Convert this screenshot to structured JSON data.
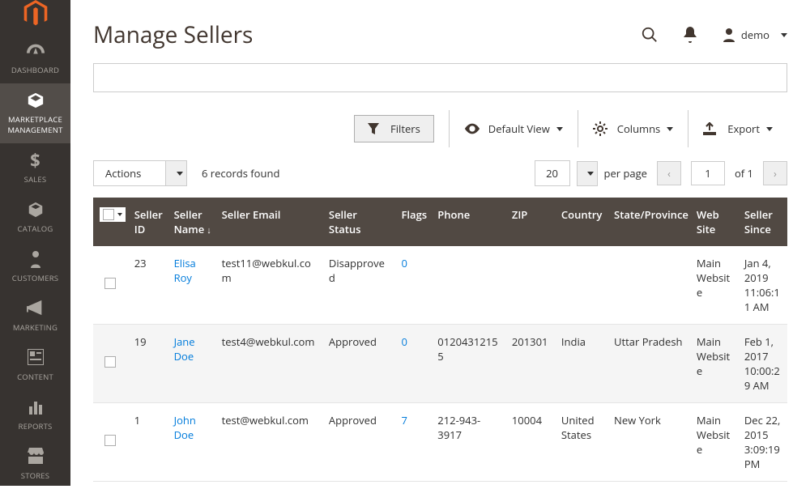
{
  "sidebar": {
    "items": [
      {
        "label": "DASHBOARD",
        "icon": "dashboard"
      },
      {
        "label": "MARKETPLACE MANAGEMENT",
        "icon": "marketplace",
        "active": true
      },
      {
        "label": "SALES",
        "icon": "sales"
      },
      {
        "label": "CATALOG",
        "icon": "catalog"
      },
      {
        "label": "CUSTOMERS",
        "icon": "customers"
      },
      {
        "label": "MARKETING",
        "icon": "marketing"
      },
      {
        "label": "CONTENT",
        "icon": "content"
      },
      {
        "label": "REPORTS",
        "icon": "reports"
      },
      {
        "label": "STORES",
        "icon": "stores"
      }
    ]
  },
  "header": {
    "title": "Manage Sellers",
    "user": "demo"
  },
  "toolbar": {
    "filters": "Filters",
    "view": "Default View",
    "columns": "Columns",
    "export": "Export"
  },
  "grid": {
    "actions": "Actions",
    "records": "6 records found",
    "per_page_value": "20",
    "per_page_label": "per page",
    "current_page": "1",
    "total_pages": "of 1"
  },
  "columns": [
    "Seller ID",
    "Seller Name",
    "Seller Email",
    "Seller Status",
    "Flags",
    "Phone",
    "ZIP",
    "Country",
    "State/Province",
    "Web Site",
    "Seller Since"
  ],
  "rows": [
    {
      "id": "23",
      "name": "Elisa Roy",
      "email": "test11@webkul.com",
      "status": "Disapproved",
      "flags": "0",
      "phone": "",
      "zip": "",
      "country": "",
      "state": "",
      "web": "Main Website",
      "since": "Jan 4, 2019 11:06:11 AM"
    },
    {
      "id": "19",
      "name": "Jane Doe",
      "email": "test4@webkul.com",
      "status": "Approved",
      "flags": "0",
      "phone": "01204312155",
      "zip": "201301",
      "country": "India",
      "state": "Uttar Pradesh",
      "web": "Main Website",
      "since": "Feb 1, 2017 10:00:29 AM"
    },
    {
      "id": "1",
      "name": "John Doe",
      "email": "test@webkul.com",
      "status": "Approved",
      "flags": "7",
      "phone": "212-943-3917",
      "zip": "10004",
      "country": "United States",
      "state": "New York",
      "web": "Main Website",
      "since": "Dec 22, 2015 3:09:19 PM"
    }
  ]
}
